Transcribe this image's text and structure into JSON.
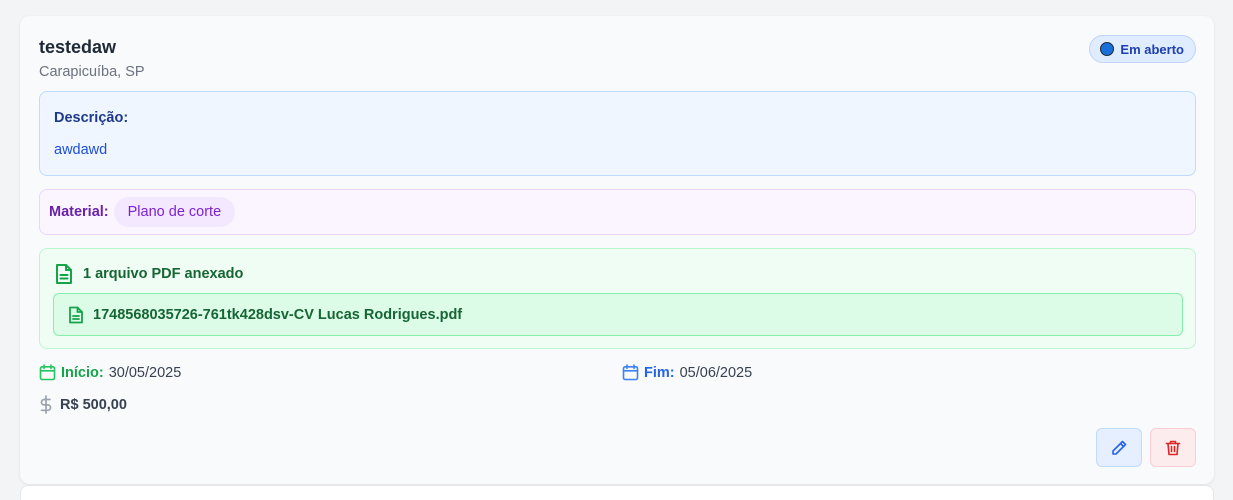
{
  "card": {
    "title": "testedaw",
    "location": "Carapicuíba, SP",
    "status": {
      "label": "Em aberto",
      "color": "#1a6fd8"
    },
    "description": {
      "label": "Descrição:",
      "text": "awdawd"
    },
    "material": {
      "label": "Material:",
      "value": "Plano de corte"
    },
    "attachments": {
      "summary": "1 arquivo PDF anexado",
      "files": [
        "1748568035726-761tk428dsv-CV Lucas Rodrigues.pdf"
      ]
    },
    "start": {
      "label": "Início:",
      "value": "30/05/2025"
    },
    "end": {
      "label": "Fim:",
      "value": "05/06/2025"
    },
    "price": "R$ 500,00",
    "actions": {
      "edit_icon": "pencil-icon",
      "delete_icon": "trash-icon"
    }
  }
}
